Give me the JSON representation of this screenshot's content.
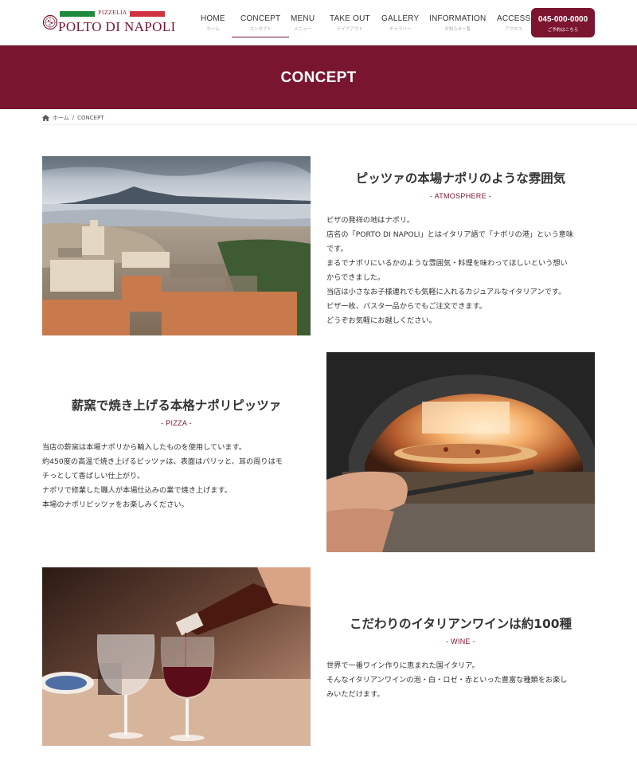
{
  "header": {
    "logo": {
      "brand_sub": "PIZZELIA",
      "brand_name": "POLTO DI NAPOLI"
    },
    "nav": [
      {
        "en": "HOME",
        "ja": "ホーム"
      },
      {
        "en": "CONCEPT",
        "ja": "コンセプト"
      },
      {
        "en": "MENU",
        "ja": "メニュー"
      },
      {
        "en": "TAKE OUT",
        "ja": "テイクアウト"
      },
      {
        "en": "GALLERY",
        "ja": "ギャラリー"
      },
      {
        "en": "INFORMATION",
        "ja": "お知らせ一覧"
      },
      {
        "en": "ACCESS",
        "ja": "アクセス"
      }
    ],
    "tel_button": {
      "number": "045-000-0000",
      "note": "ご予約はこちら"
    }
  },
  "banner": {
    "title": "CONCEPT"
  },
  "breadcrumb": {
    "home": "ホーム",
    "separator": "/",
    "current": "CONCEPT"
  },
  "sections": [
    {
      "title": "ピッツァの本場ナポリのような雰囲気",
      "tag": "- ATMOSPHERE -",
      "lines": [
        "ピザの発祥の地はナポリ。",
        "店名の「PORTO DI NAPOLI」とはイタリア語で「ナポリの港」という意味",
        "です。",
        "まるでナポリにいるかのような雰囲気・料理を味わってほしいという想い",
        "からできました。",
        "当店は小さなお子様連れでも気軽に入れるカジュアルなイタリアンです。",
        "ピザ一枚、パスタ一品からでもご注文できます。",
        "どうぞお気軽にお越しください。"
      ]
    },
    {
      "title": "薪窯で焼き上げる本格ナポリピッツァ",
      "tag": "- PIZZA -",
      "lines": [
        "当店の薪窯は本場ナポリから輸入したものを使用しています。",
        "約450度の高温で焼き上げるピッツァは、表面はパリッと、耳の周りはモ",
        "チっとして香ばしい仕上がり。",
        "ナポリで修業した職人が本場仕込みの業で焼き上げます。",
        "本場のナポリピッツァをお楽しみください。"
      ]
    },
    {
      "title": "こだわりのイタリアンワインは約100種",
      "tag": "- WINE -",
      "lines": [
        "世界で一番ワイン作りに恵まれた国イタリア。",
        "そんなイタリアンワインの泡・白・ロゼ・赤といった豊富な種類をお楽し",
        "みいただけます。"
      ]
    }
  ],
  "colors": {
    "brand": "#7a1530",
    "italy_green": "#1f8a3b",
    "italy_red": "#d0333f"
  }
}
